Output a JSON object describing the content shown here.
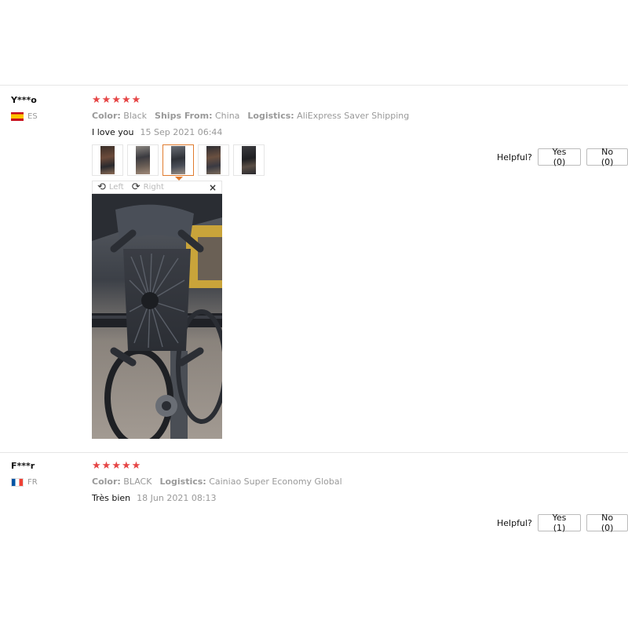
{
  "reviews": [
    {
      "user": "Y***o",
      "country": "ES",
      "rating": 5,
      "attributes": [
        {
          "label": "Color:",
          "value": "Black"
        },
        {
          "label": "Ships From:",
          "value": "China"
        },
        {
          "label": "Logistics:",
          "value": "AliExpress Saver Shipping"
        }
      ],
      "text": "I love you",
      "date": "15 Sep 2021 06:44",
      "helpful_label": "Helpful?",
      "yes_label": "Yes (0)",
      "no_label": "No (0)",
      "photo_count": 5,
      "active_photo_index": 2,
      "viewer": {
        "left_label": "Left",
        "right_label": "Right",
        "close_label": "×"
      }
    },
    {
      "user": "F***r",
      "country": "FR",
      "rating": 5,
      "attributes": [
        {
          "label": "Color:",
          "value": "BLACK"
        },
        {
          "label": "Logistics:",
          "value": "Cainiao Super Economy Global"
        }
      ],
      "text": "Très bien",
      "date": "18 Jun 2021 08:13",
      "helpful_label": "Helpful?",
      "yes_label": "Yes (1)",
      "no_label": "No (0)"
    }
  ],
  "colors": {
    "star": "#e64545",
    "active_thumb": "#e07b2e",
    "divider": "#e6e6e6"
  },
  "icons": {
    "rotate_left": "rotate-left-icon",
    "rotate_right": "rotate-right-icon",
    "close": "close-icon",
    "star": "star-icon"
  }
}
